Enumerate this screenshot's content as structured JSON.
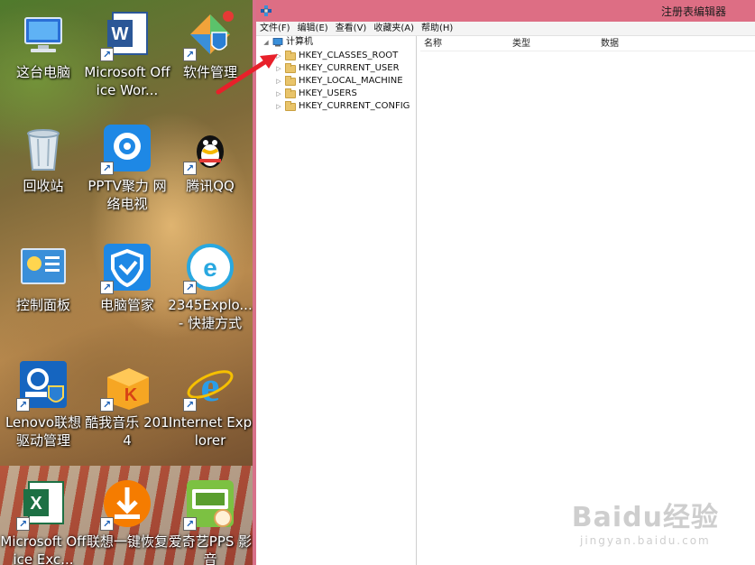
{
  "desktop": {
    "icons": [
      {
        "label": "这台电脑",
        "icon": "computer-icon"
      },
      {
        "label": "Microsoft Office Wor...",
        "icon": "word-icon"
      },
      {
        "label": "软件管理",
        "icon": "software-manager-icon"
      },
      {
        "label": "回收站",
        "icon": "recycle-bin-icon"
      },
      {
        "label": "PPTV聚力 网络电视",
        "icon": "pptv-icon"
      },
      {
        "label": "腾讯QQ",
        "icon": "qq-icon"
      },
      {
        "label": "控制面板",
        "icon": "control-panel-icon"
      },
      {
        "label": "电脑管家",
        "icon": "pc-manager-icon"
      },
      {
        "label": "2345Explo... - 快捷方式",
        "icon": "2345-explorer-icon"
      },
      {
        "label": "Lenovo联想驱动管理",
        "icon": "lenovo-driver-icon"
      },
      {
        "label": "酷我音乐 2014",
        "icon": "kuwo-music-icon"
      },
      {
        "label": "Internet Explorer",
        "icon": "ie-icon"
      },
      {
        "label": "Microsoft Office Exc...",
        "icon": "excel-icon"
      },
      {
        "label": "联想一键恢复",
        "icon": "lenovo-recovery-icon"
      },
      {
        "label": "爱奇艺PPS 影音",
        "icon": "iqiyi-icon"
      }
    ]
  },
  "window": {
    "title": "注册表编辑器",
    "menu": [
      "文件(F)",
      "编辑(E)",
      "查看(V)",
      "收藏夹(A)",
      "帮助(H)"
    ],
    "tree": {
      "root": "计算机",
      "children": [
        "HKEY_CLASSES_ROOT",
        "HKEY_CURRENT_USER",
        "HKEY_LOCAL_MACHINE",
        "HKEY_USERS",
        "HKEY_CURRENT_CONFIG"
      ]
    },
    "columns": [
      "名称",
      "类型",
      "数据"
    ]
  },
  "watermark": {
    "logo": "Baidu经验",
    "url": "jingyan.baidu.com"
  },
  "colors": {
    "titlebar": "#dd6e84",
    "annotation_arrow": "#e8202a"
  }
}
